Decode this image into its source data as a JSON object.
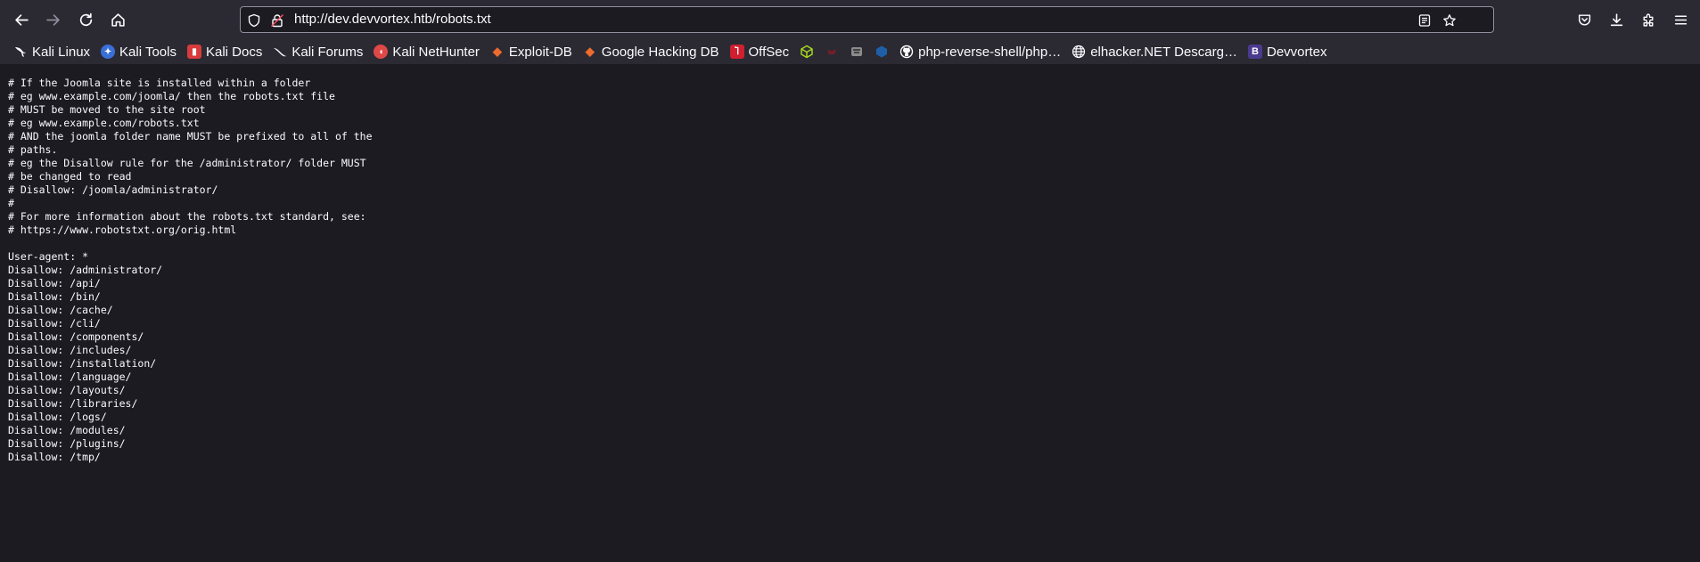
{
  "toolbar": {
    "url": "http://dev.devvortex.htb/robots.txt"
  },
  "bookmarks": [
    {
      "label": "Kali Linux",
      "icon": "kali-dragon-icon"
    },
    {
      "label": "Kali Tools",
      "icon": "kali-tools-icon"
    },
    {
      "label": "Kali Docs",
      "icon": "kali-docs-icon"
    },
    {
      "label": "Kali Forums",
      "icon": "kali-forums-icon"
    },
    {
      "label": "Kali NetHunter",
      "icon": "nethunter-icon"
    },
    {
      "label": "Exploit-DB",
      "icon": "exploit-db-icon"
    },
    {
      "label": "Google Hacking DB",
      "icon": "ghdb-icon"
    },
    {
      "label": "OffSec",
      "icon": "offsec-icon"
    },
    {
      "label": "",
      "icon": "cube-icon"
    },
    {
      "label": "",
      "icon": "red-bug-icon"
    },
    {
      "label": "",
      "icon": "badger-icon"
    },
    {
      "label": "",
      "icon": "blue-hex-icon"
    },
    {
      "label": "php-reverse-shell/php…",
      "icon": "github-icon"
    },
    {
      "label": "elhacker.NET Descarg…",
      "icon": "globe-icon"
    },
    {
      "label": "Devvortex",
      "icon": "devvortex-b-icon"
    }
  ],
  "robots_txt": "# If the Joomla site is installed within a folder\n# eg www.example.com/joomla/ then the robots.txt file\n# MUST be moved to the site root\n# eg www.example.com/robots.txt\n# AND the joomla folder name MUST be prefixed to all of the\n# paths.\n# eg the Disallow rule for the /administrator/ folder MUST\n# be changed to read\n# Disallow: /joomla/administrator/\n#\n# For more information about the robots.txt standard, see:\n# https://www.robotstxt.org/orig.html\n\nUser-agent: *\nDisallow: /administrator/\nDisallow: /api/\nDisallow: /bin/\nDisallow: /cache/\nDisallow: /cli/\nDisallow: /components/\nDisallow: /includes/\nDisallow: /installation/\nDisallow: /language/\nDisallow: /layouts/\nDisallow: /libraries/\nDisallow: /logs/\nDisallow: /modules/\nDisallow: /plugins/\nDisallow: /tmp/"
}
